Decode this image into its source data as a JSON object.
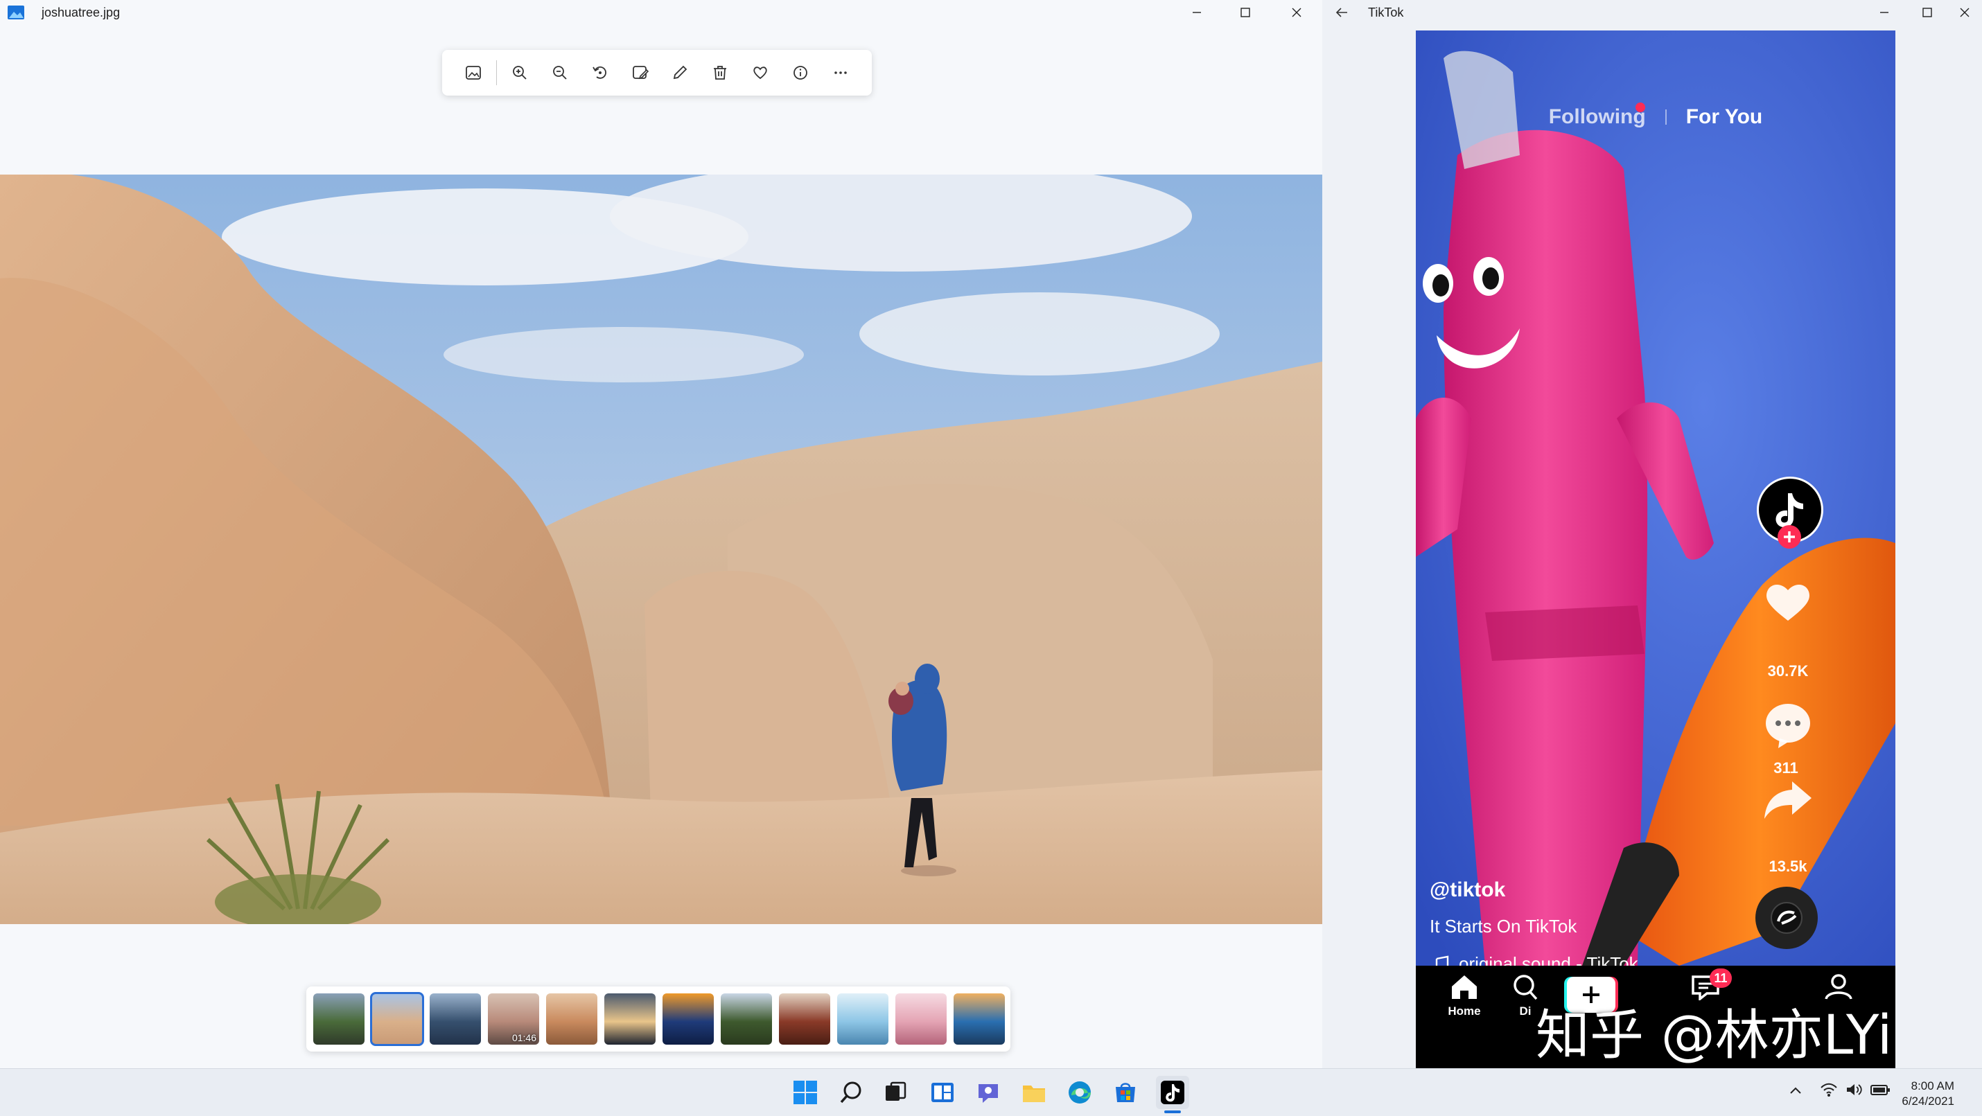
{
  "photos_window": {
    "title": "joshuatree.jpg",
    "toolbar": [
      "image-icon",
      "zoom-in-icon",
      "zoom-out-icon",
      "rotate-icon",
      "edit-image-icon",
      "draw-icon",
      "delete-icon",
      "heart-icon",
      "info-icon",
      "more-icon"
    ],
    "filmstrip": [
      {
        "name": "thumb-forest"
      },
      {
        "name": "thumb-joshuatree",
        "selected": true
      },
      {
        "name": "thumb-tower"
      },
      {
        "name": "thumb-video",
        "duration": "01:46"
      },
      {
        "name": "thumb-canyon"
      },
      {
        "name": "thumb-sunset-figure"
      },
      {
        "name": "thumb-orange"
      },
      {
        "name": "thumb-trees"
      },
      {
        "name": "thumb-rust"
      },
      {
        "name": "thumb-water"
      },
      {
        "name": "thumb-pink"
      },
      {
        "name": "thumb-coast"
      }
    ]
  },
  "tiktok_window": {
    "title": "TikTok",
    "tabs": {
      "following": "Following",
      "for_you": "For You"
    },
    "likes": "30.7K",
    "comments": "311",
    "shares": "13.5k",
    "username": "@tiktok",
    "caption": "It Starts On TikTok",
    "sound": "original sound - TikTok",
    "nav": {
      "home": "Home",
      "discover": "Di",
      "inbox_badge": "11"
    }
  },
  "taskbar": {
    "time": "8:00 AM",
    "date": "6/24/2021"
  },
  "watermark": "知乎 @林亦LYi",
  "colors": {
    "accent": "#2b6fd6",
    "tiktok_pink": "#fe2c55",
    "taskbar": "#e9edf3"
  }
}
